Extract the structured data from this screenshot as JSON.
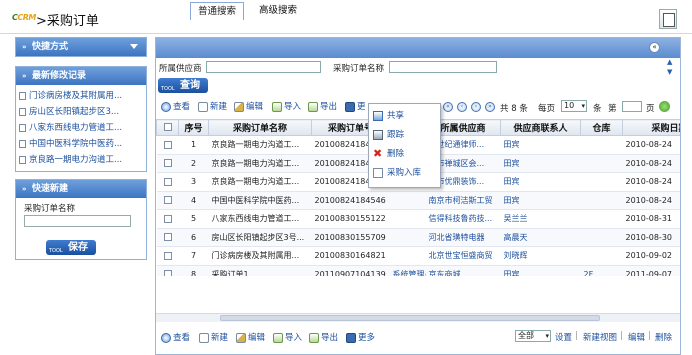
{
  "header": {
    "logo_text": "CRM",
    "title": ">采购订单"
  },
  "sidebar": {
    "shortcuts_title": "快捷方式",
    "recent_title": "最新修改记录",
    "recent_items": [
      "门诊病房楼及其附属用...",
      "房山区长阳镇起步区3...",
      "八家东西线电力管道工...",
      "中国中医科学院中医药...",
      "京良路一期电力沟道工..."
    ],
    "quick_new_title": "快速新建",
    "quick_new_label": "采购订单名称",
    "quick_new_value": "",
    "save_label": "保存",
    "tool_tag": "TOOL"
  },
  "search": {
    "tabs": [
      "普通搜索",
      "高级搜索"
    ],
    "supplier_label": "所属供应商",
    "supplier_value": "",
    "order_name_label": "采购订单名称",
    "order_name_value": "",
    "query_label": "查询",
    "tool_tag": "TOOL"
  },
  "toolbar": {
    "view": "查看",
    "new": "新建",
    "edit": "编辑",
    "import": "导入",
    "export": "导出",
    "more": "更"
  },
  "pager": {
    "total_prefix": "共",
    "total_count": "8",
    "total_suffix": "条",
    "per_page_label": "每页",
    "per_page_value": "10",
    "per_page_suffix": "条",
    "page_label": "第",
    "page_suffix": "页"
  },
  "popup_menu": [
    "共享",
    "跟踪",
    "删除",
    "采购入库"
  ],
  "table": {
    "columns": [
      "",
      "序号",
      "采购订单名称",
      "采购订单号",
      "",
      "所属供应商",
      "供应商联系人",
      "仓库",
      "采购日期"
    ],
    "rows": [
      [
        "1",
        "京良路一期电力沟道工...",
        "20100824184545",
        "",
        "南世纪通律师...",
        "田宾",
        "",
        "2010-08-24"
      ],
      [
        "2",
        "京良路一期电力沟道工...",
        "20100824184545",
        "",
        "山市禅城区会...",
        "田宾",
        "",
        "2010-08-24"
      ],
      [
        "3",
        "京良路一期电力沟道工...",
        "20100824184545",
        "",
        "庄市优鼎装饰...",
        "田宾",
        "",
        "2010-08-24"
      ],
      [
        "4",
        "中国中医科学院中医药...",
        "20100824184546",
        "",
        "南京市柯洁斯工贸",
        "田宾",
        "",
        "2010-08-24"
      ],
      [
        "5",
        "八家东西线电力管道工...",
        "20100830155122",
        "",
        "信得科技鲁药技...",
        "吴兰兰",
        "",
        "2010-08-31"
      ],
      [
        "6",
        "房山区长阳镇起步区3号...",
        "20100830155709",
        "",
        "河北省璜特电器",
        "高晨天",
        "",
        "2010-08-30"
      ],
      [
        "7",
        "门诊病房楼及其附属用...",
        "20100830164821",
        "",
        "北京世宝恒盛商贸",
        "刘晓辉",
        "",
        "2010-09-02"
      ],
      [
        "8",
        "采购订单1",
        "20110907104139",
        "系统管理员",
        "京东商城",
        "田宾",
        "2F",
        "2011-09-07"
      ]
    ]
  },
  "bottom_bar": {
    "view": "查看",
    "new": "新建",
    "edit": "编辑",
    "import": "导入",
    "export": "导出",
    "more": "更多",
    "view_select": "全部",
    "settings": "设置",
    "new_view": "新建视图",
    "edit_link": "编辑",
    "delete_link": "删除"
  }
}
